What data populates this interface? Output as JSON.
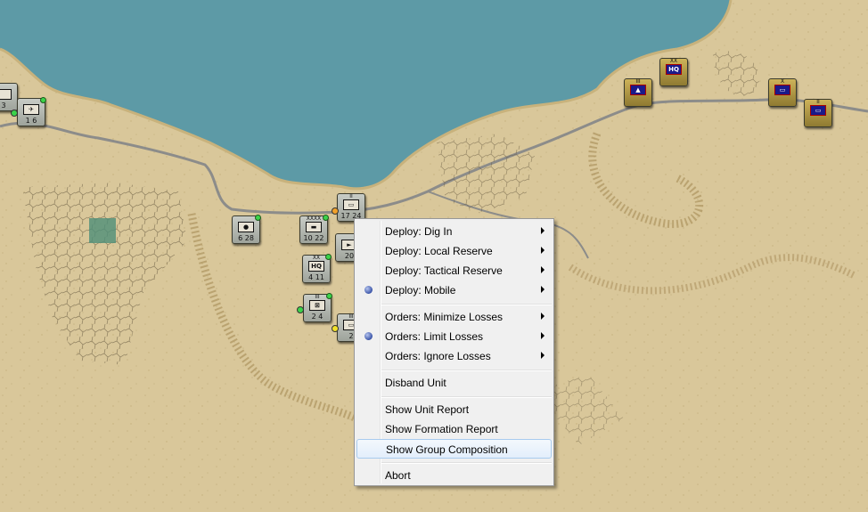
{
  "map": {
    "counters": [
      {
        "id": "c1",
        "size": "",
        "sym": "✈",
        "str": "1  6",
        "style": "gray"
      },
      {
        "id": "c2",
        "size": "",
        "sym": "●",
        "str": "6  28",
        "style": "gray"
      },
      {
        "id": "c3",
        "size": "XXXX",
        "sym": "▬",
        "str": "10  22",
        "style": "gray"
      },
      {
        "id": "c4",
        "size": "II",
        "sym": "▭",
        "str": "17  24",
        "style": "gray"
      },
      {
        "id": "c5",
        "size": "",
        "sym": "►",
        "str": "20",
        "style": "gray"
      },
      {
        "id": "c6",
        "size": "XX",
        "sym": "HQ",
        "str": "4  11",
        "style": "gray"
      },
      {
        "id": "c7",
        "size": "III",
        "sym": "⊠",
        "str": "2  4",
        "style": "gray"
      },
      {
        "id": "c8",
        "size": "III",
        "sym": "▭",
        "str": "2",
        "style": "gray"
      },
      {
        "id": "c9",
        "size": "",
        "sym": "",
        "str": "3",
        "style": "gray"
      },
      {
        "id": "a1",
        "size": "III",
        "sym": "▲",
        "str": "",
        "style": "axis"
      },
      {
        "id": "a2",
        "size": "XX",
        "sym": "HQ",
        "str": "",
        "style": "axis"
      },
      {
        "id": "a3",
        "size": "X",
        "sym": "▭",
        "str": "",
        "style": "axis"
      },
      {
        "id": "a4",
        "size": "II",
        "sym": "▭",
        "str": "",
        "style": "axis"
      }
    ]
  },
  "context_menu": {
    "items": [
      {
        "label": "Deploy: Dig In",
        "submenu": true,
        "checked": false
      },
      {
        "label": "Deploy: Local Reserve",
        "submenu": true,
        "checked": false
      },
      {
        "label": "Deploy: Tactical Reserve",
        "submenu": true,
        "checked": false
      },
      {
        "label": "Deploy: Mobile",
        "submenu": true,
        "checked": true
      },
      {
        "label": "Orders: Minimize Losses",
        "submenu": true,
        "checked": false
      },
      {
        "label": "Orders: Limit Losses",
        "submenu": true,
        "checked": true
      },
      {
        "label": "Orders: Ignore Losses",
        "submenu": true,
        "checked": false
      },
      {
        "label": "Disband Unit",
        "submenu": false,
        "checked": false
      },
      {
        "label": "Show Unit Report",
        "submenu": false,
        "checked": false
      },
      {
        "label": "Show Formation Report",
        "submenu": false,
        "checked": false
      },
      {
        "label": "Show Group Composition",
        "submenu": false,
        "checked": false,
        "highlighted": true
      },
      {
        "label": "Abort",
        "submenu": false,
        "checked": false
      }
    ]
  },
  "colors": {
    "sea": "#5d9aa6",
    "desert": "#d9c79a",
    "road": "#8c8c8a",
    "highlight": "#e3eefb"
  }
}
